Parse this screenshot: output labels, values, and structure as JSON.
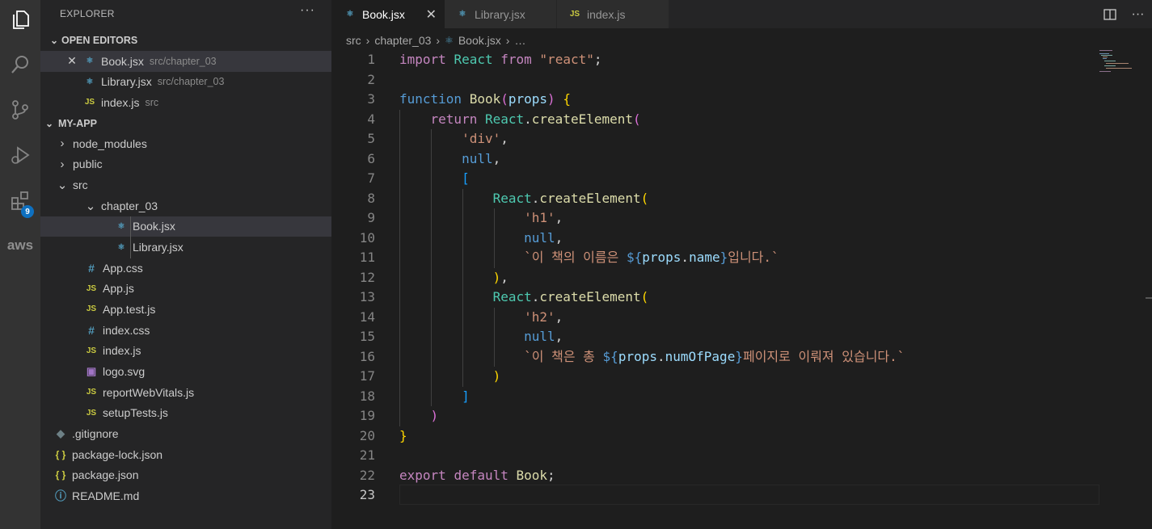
{
  "activity_bar": {
    "icons": [
      "files-icon",
      "search-icon",
      "source-control-icon",
      "run-debug-icon",
      "extensions-icon",
      "aws-icon"
    ],
    "extensions_badge": "9",
    "aws_label": "aws"
  },
  "explorer": {
    "title": "EXPLORER",
    "more": "···",
    "open_editors": {
      "title": "OPEN EDITORS",
      "items": [
        {
          "name": "Book.jsx",
          "path": "src/chapter_03",
          "type": "react"
        },
        {
          "name": "Library.jsx",
          "path": "src/chapter_03",
          "type": "react"
        },
        {
          "name": "index.js",
          "path": "src",
          "type": "js"
        }
      ]
    },
    "project": {
      "title": "MY-APP",
      "tree": [
        {
          "name": "node_modules",
          "kind": "folder"
        },
        {
          "name": "public",
          "kind": "folder"
        },
        {
          "name": "src",
          "kind": "folder-open"
        },
        {
          "name": "chapter_03",
          "kind": "folder-open"
        },
        {
          "name": "Book.jsx",
          "kind": "react"
        },
        {
          "name": "Library.jsx",
          "kind": "react"
        },
        {
          "name": "App.css",
          "kind": "css"
        },
        {
          "name": "App.js",
          "kind": "js"
        },
        {
          "name": "App.test.js",
          "kind": "js"
        },
        {
          "name": "index.css",
          "kind": "css"
        },
        {
          "name": "index.js",
          "kind": "js"
        },
        {
          "name": "logo.svg",
          "kind": "svg"
        },
        {
          "name": "reportWebVitals.js",
          "kind": "js"
        },
        {
          "name": "setupTests.js",
          "kind": "js"
        },
        {
          "name": ".gitignore",
          "kind": "git"
        },
        {
          "name": "package-lock.json",
          "kind": "json"
        },
        {
          "name": "package.json",
          "kind": "json"
        },
        {
          "name": "README.md",
          "kind": "info"
        }
      ]
    }
  },
  "tabs": [
    {
      "label": "Book.jsx",
      "active": true
    },
    {
      "label": "Library.jsx",
      "active": false
    },
    {
      "label": "index.js",
      "active": false
    }
  ],
  "icon_glyphs": {
    "js": "JS",
    "css": "#",
    "json": "{ }",
    "info": "ⓘ",
    "git": "◆",
    "svg": "▣",
    "react": "⚛"
  },
  "breadcrumb": [
    "src",
    "chapter_03",
    "Book.jsx",
    "…"
  ],
  "editor": {
    "current_line": 23,
    "lines": [
      "import React from \"react\";",
      "",
      "function Book(props) {",
      "    return React.createElement(",
      "        'div',",
      "        null,",
      "        [",
      "            React.createElement(",
      "                'h1',",
      "                null,",
      "                `이 책의 이름은 ${props.name}입니다.`",
      "            ),",
      "            React.createElement(",
      "                'h2',",
      "                null,",
      "                `이 책은 총 ${props.numOfPage}페이지로 이뤄져 있습니다.`",
      "            )",
      "        ]",
      "    )",
      "}",
      "",
      "export default Book;",
      ""
    ]
  }
}
